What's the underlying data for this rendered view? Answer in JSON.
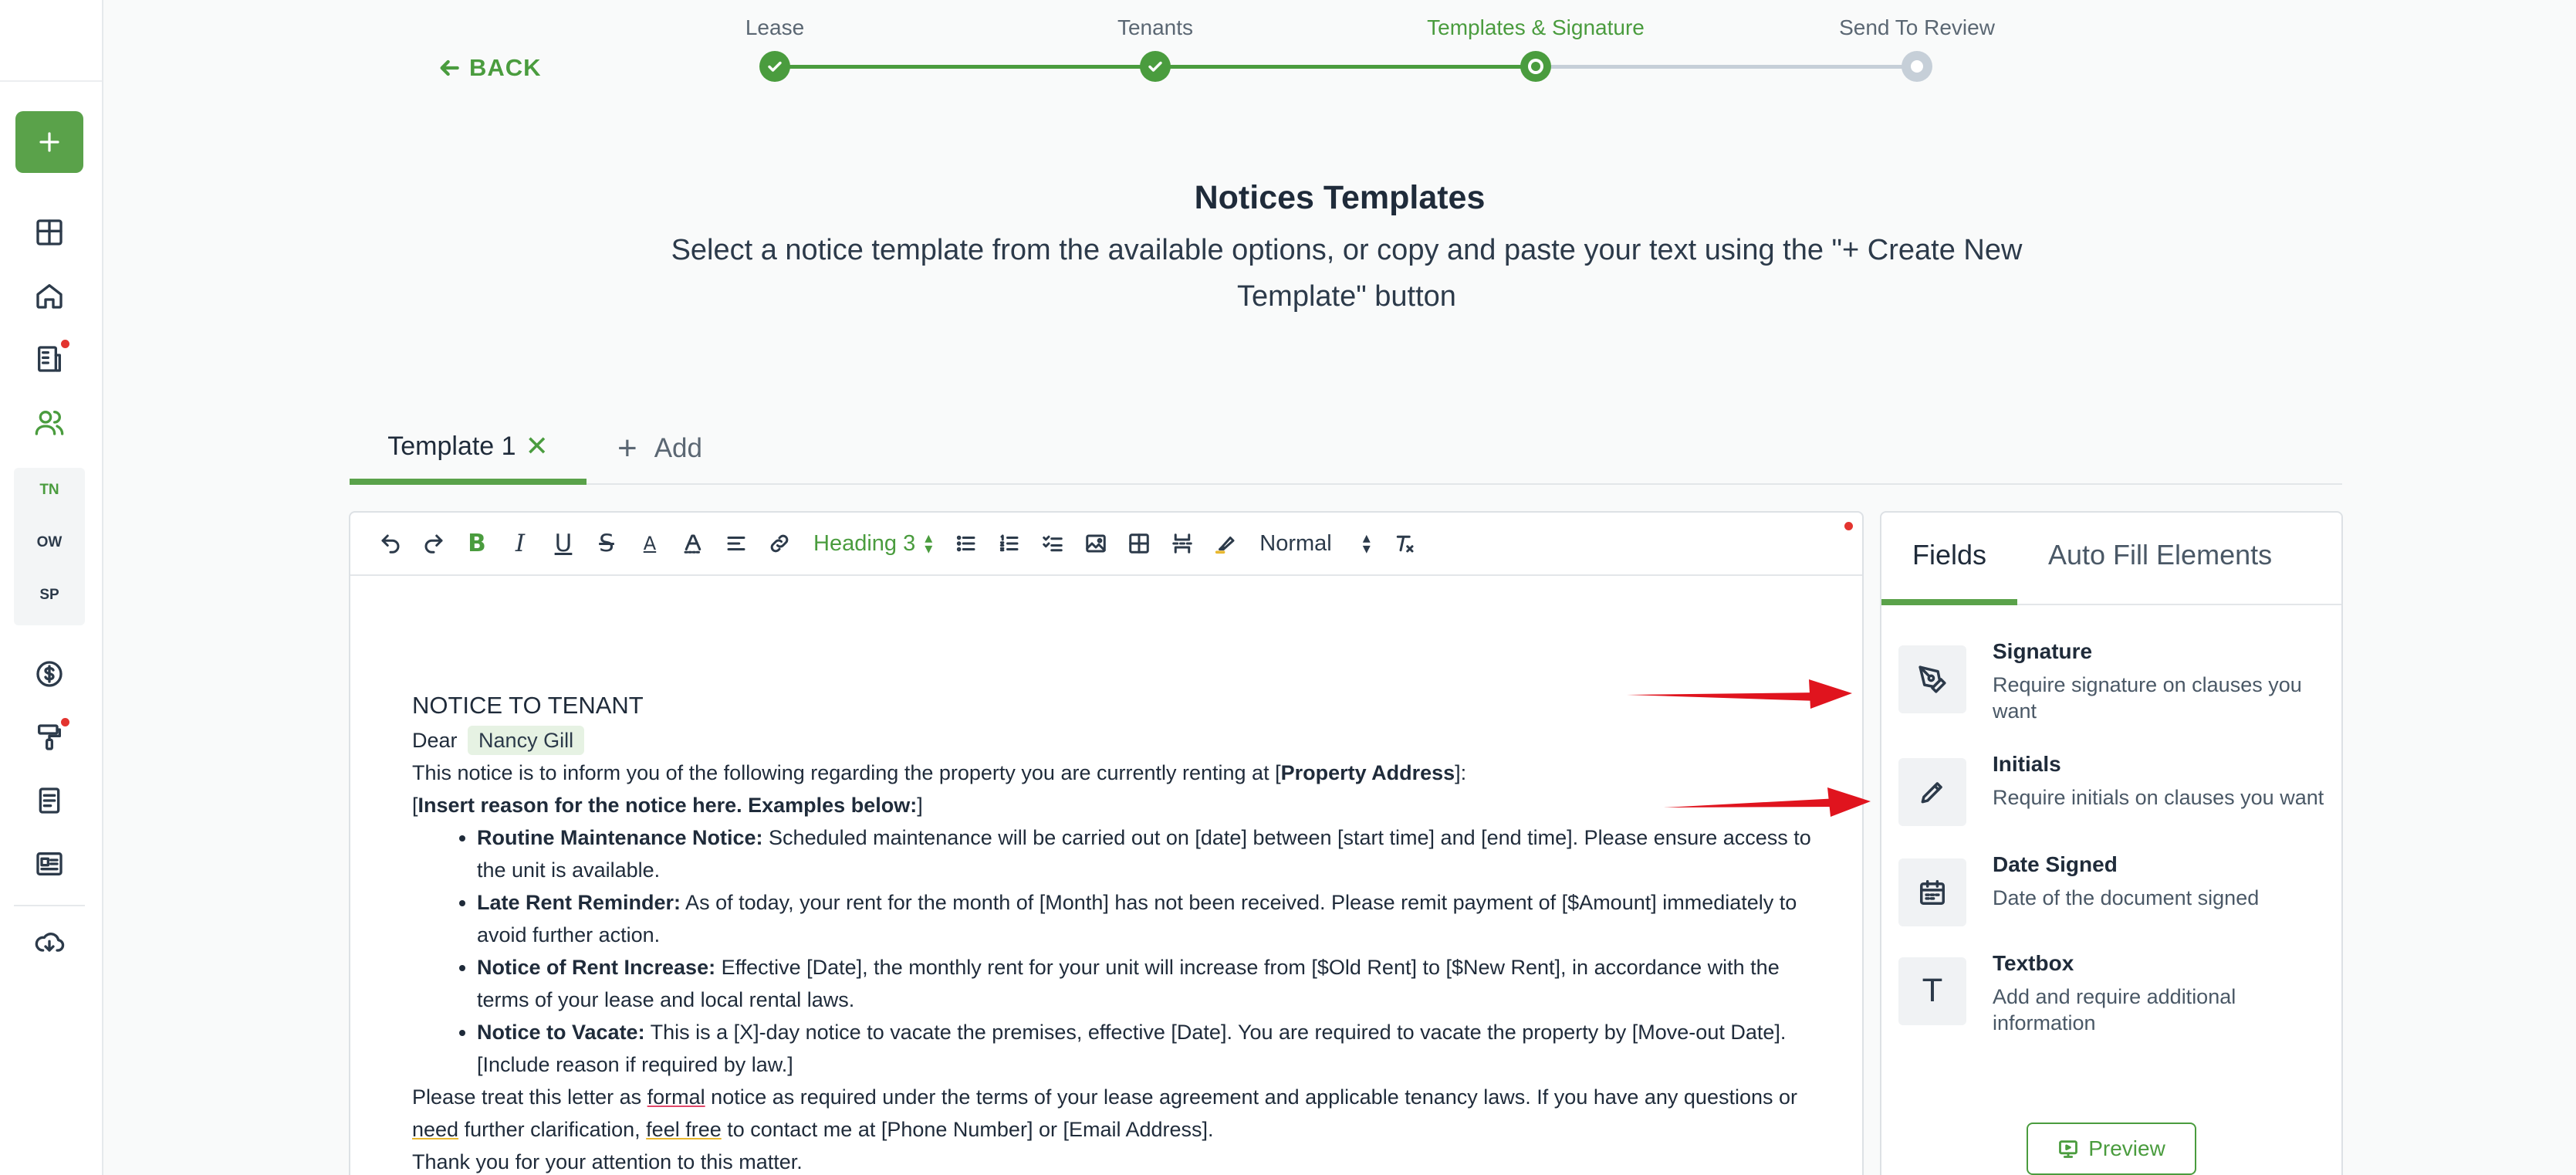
{
  "back": {
    "label": "BACK"
  },
  "stepper": {
    "steps": [
      {
        "label": "Lease",
        "state": "done"
      },
      {
        "label": "Tenants",
        "state": "done"
      },
      {
        "label": "Templates & Signature",
        "state": "current"
      },
      {
        "label": "Send To Review",
        "state": "future"
      }
    ]
  },
  "page": {
    "title": "Notices Templates",
    "subtitle": "Select a notice template from the available options, or copy and paste your text using the \"+ Create New Template\" button"
  },
  "tabs": {
    "items": [
      {
        "label": "Template 1",
        "close": "✕"
      }
    ],
    "add_label": "Add"
  },
  "sidebar": {
    "abbrs": [
      "TN",
      "OW",
      "SP"
    ]
  },
  "toolbar": {
    "heading_select": "Heading 3",
    "size_select": "Normal",
    "bold": "B",
    "italic": "I",
    "underline": "U",
    "strike": "S",
    "color": "A"
  },
  "document": {
    "heading": "NOTICE TO TENANT",
    "dear": "Dear",
    "recipient": "Nancy Gill",
    "intro_prefix": "This notice is to inform you of the following regarding the property you are currently renting at [",
    "property_placeholder": "Property Address",
    "intro_suffix": "]:",
    "reason_open": "[",
    "reason_text": "Insert reason for the notice here. Examples below:",
    "reason_close": "]",
    "items": [
      {
        "title": "Routine Maintenance Notice:",
        "text": " Scheduled maintenance will be carried out on [date] between [start time] and [end time]. Please ensure access to the unit is available."
      },
      {
        "title": "Late Rent Reminder:",
        "text": " As of today, your rent for the month of [Month] has not been received. Please remit payment of [$Amount] immediately to avoid further action."
      },
      {
        "title": "Notice of Rent Increase:",
        "text": " Effective [Date], the monthly rent for your unit will increase from [$Old Rent] to [$New Rent], in accordance with the terms of your lease and local rental laws."
      },
      {
        "title": "Notice to Vacate:",
        "text": " This is a [X]-day notice to vacate the premises, effective [Date]. You are required to vacate the property by [Move-out Date]. [Include reason if required by law.]"
      }
    ],
    "closing_1": "Please treat this letter as ",
    "closing_formal": "formal",
    "closing_2": " notice as required under the terms of your lease agreement and applicable tenancy laws. If you have any questions or ",
    "closing_need": "need",
    "closing_3": " further clarification, ",
    "closing_feel": "feel free",
    "closing_4": " to contact me at [Phone Number] or [Email Address].",
    "thanks": "Thank you for your attention to this matter."
  },
  "panel": {
    "tabs": [
      "Fields",
      "Auto Fill Elements"
    ],
    "fields": [
      {
        "title": "Signature",
        "desc": "Require signature on clauses you want",
        "icon": "pen-nib-icon"
      },
      {
        "title": "Initials",
        "desc": "Require initials on clauses you want",
        "icon": "pencil-icon"
      },
      {
        "title": "Date Signed",
        "desc": "Date of the document signed",
        "icon": "calendar-icon"
      },
      {
        "title": "Textbox",
        "desc": "Add and require additional information",
        "icon": "text-icon",
        "glyph": "T"
      }
    ],
    "preview_label": "Preview"
  },
  "colors": {
    "accent": "#4a9c3e",
    "accent_button": "#5aa24a",
    "notify_dot": "#e3342f",
    "annotation_arrow": "#e0141e"
  }
}
